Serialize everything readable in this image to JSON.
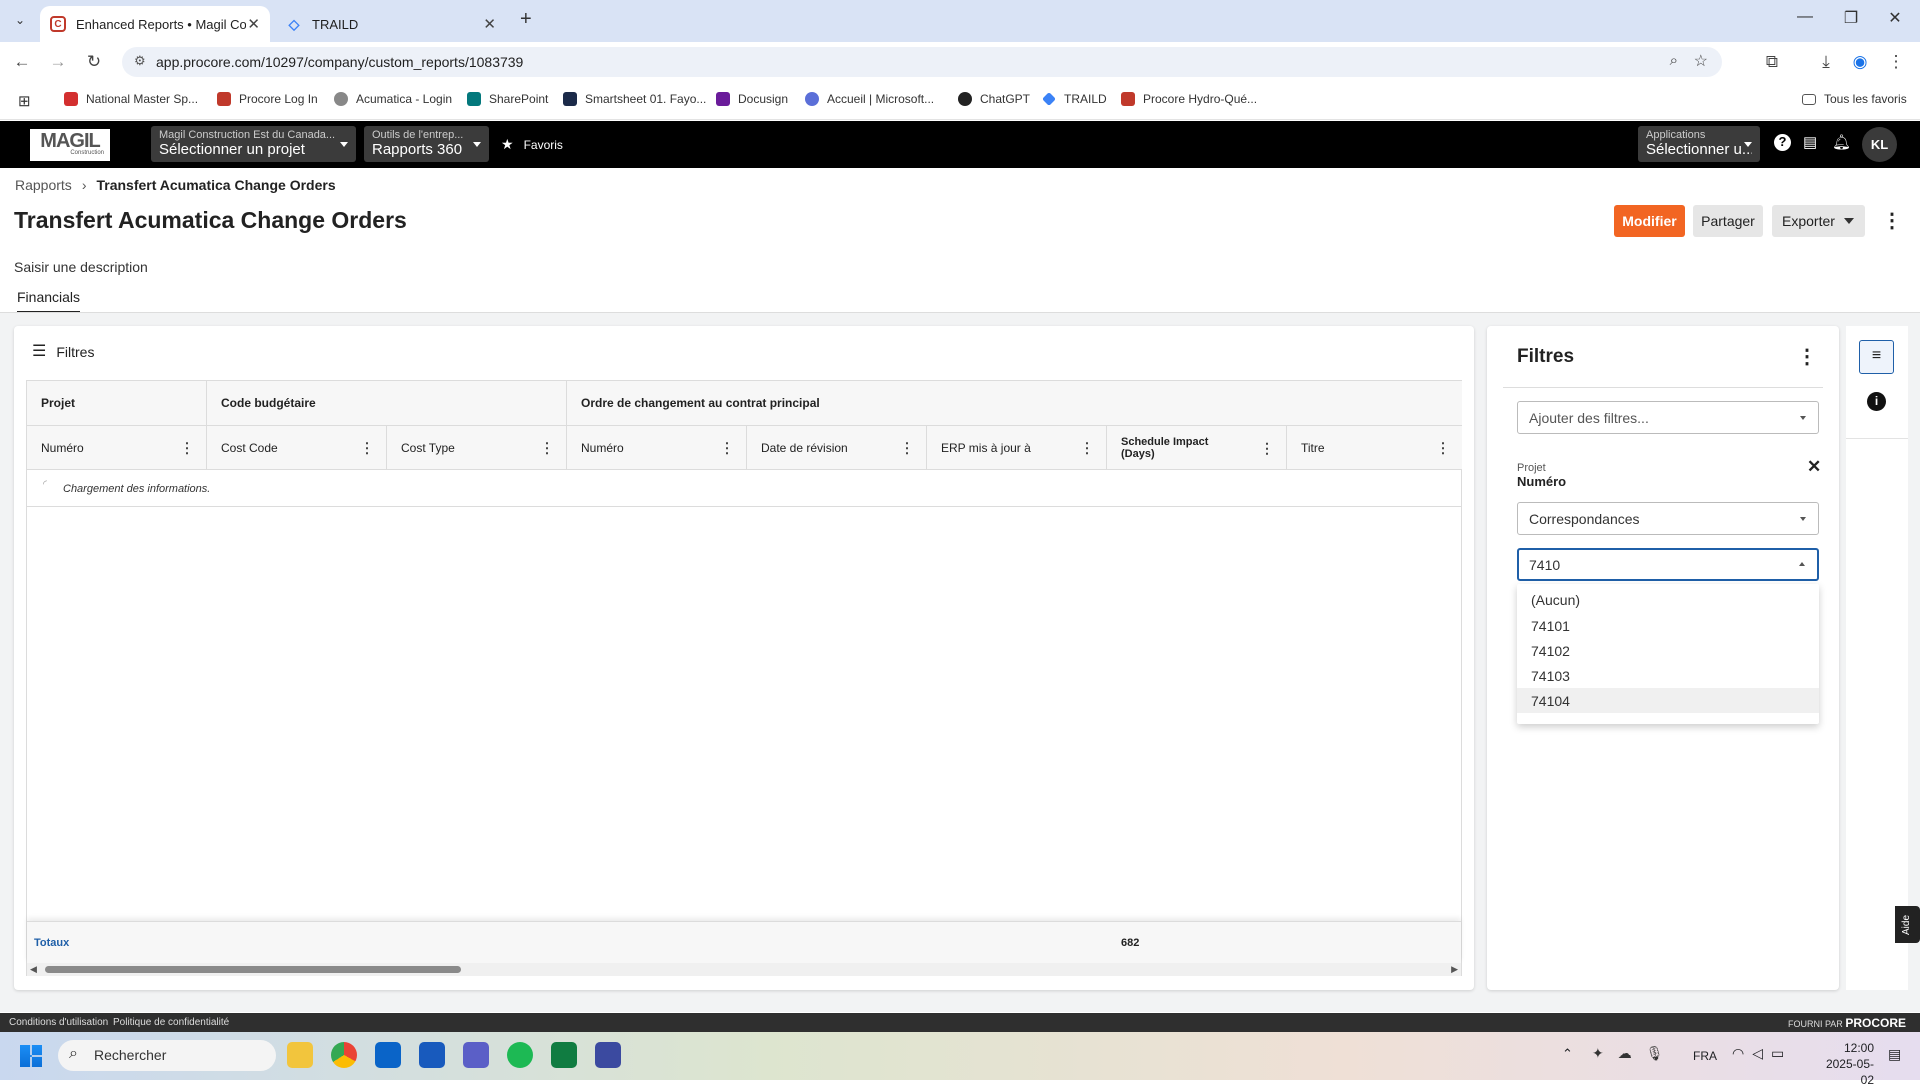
{
  "browser": {
    "tabs": [
      {
        "title": "Enhanced Reports • Magil Cons",
        "active": true
      },
      {
        "title": "TRAILD",
        "active": false
      }
    ],
    "url": "app.procore.com/10297/company/custom_reports/1083739",
    "bookmarks": [
      "National Master Sp...",
      "Procore Log In",
      "Acumatica - Login",
      "SharePoint",
      "Smartsheet 01. Fayo...",
      "Docusign",
      "Accueil | Microsoft...",
      "ChatGPT",
      "TRAILD",
      "Procore Hydro-Qué..."
    ],
    "all_bookmarks": "Tous les favoris"
  },
  "procore": {
    "logo": "MAGIL",
    "logo_sub": "Construction",
    "project_selector": {
      "company": "Magil Construction Est du Canada...",
      "value": "Sélectionner un projet"
    },
    "tools_selector": {
      "label": "Outils de l'entrep...",
      "value": "Rapports 360"
    },
    "favorites": "Favoris",
    "apps_selector": {
      "label": "Applications",
      "value": "Sélectionner u..."
    },
    "avatar": "KL"
  },
  "page": {
    "breadcrumb_root": "Rapports",
    "breadcrumb_current": "Transfert Acumatica Change Orders",
    "title": "Transfert Acumatica Change Orders",
    "buttons": {
      "modify": "Modifier",
      "share": "Partager",
      "export": "Exporter"
    },
    "description": "Saisir une description",
    "tab": "Financials"
  },
  "report": {
    "filters_label": "Filtres",
    "groups": [
      "Projet",
      "Code budgétaire",
      "Ordre de changement au contrat principal"
    ],
    "columns": [
      "Numéro",
      "Cost Code",
      "Cost Type",
      "Numéro",
      "Date de révision",
      "ERP mis à jour à",
      "Schedule Impact (Days)",
      "Titre"
    ],
    "loading": "Chargement des informations.",
    "totals_label": "Totaux",
    "totals_value": "682"
  },
  "filter_panel": {
    "title": "Filtres",
    "add_placeholder": "Ajouter des filtres...",
    "field_group": "Projet",
    "field_name": "Numéro",
    "operator": "Correspondances",
    "value": "7410",
    "options": [
      "(Aucun)",
      "74101",
      "74102",
      "74103",
      "74104"
    ],
    "help": "Aide"
  },
  "footer": {
    "terms": "Conditions d'utilisation",
    "privacy": "Politique de confidentialité",
    "powered_by": "FOURNI PAR",
    "powered_brand": "PROCORE"
  },
  "taskbar": {
    "search": "Rechercher",
    "lang": "FRA",
    "time": "12:00",
    "date": "2025-05-02"
  },
  "colors": {
    "accent": "#f26522",
    "dark": "#000000",
    "link": "#1f5fa8"
  }
}
